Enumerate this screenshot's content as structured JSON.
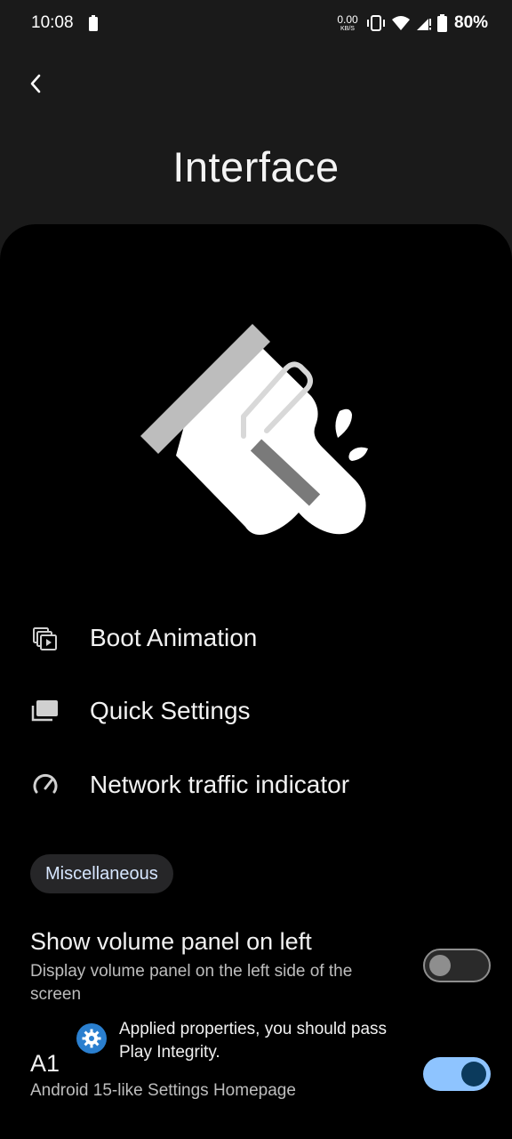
{
  "status_bar": {
    "time": "10:08",
    "net_speed_value": "0.00",
    "net_speed_unit": "KB/S",
    "battery_percent": "80%"
  },
  "header": {
    "back_icon": "chevron-left-icon",
    "title": "Interface"
  },
  "menu": {
    "items": [
      {
        "label": "Boot Animation",
        "icon": "slideshow-icon"
      },
      {
        "label": "Quick Settings",
        "icon": "tiles-icon"
      },
      {
        "label": "Network traffic indicator",
        "icon": "speedometer-icon"
      }
    ]
  },
  "misc": {
    "chip_label": "Miscellaneous",
    "settings": [
      {
        "title": "Show volume panel on left",
        "summary": "Display volume panel on the left side of the screen",
        "enabled": false
      },
      {
        "title": "A1",
        "summary": "Android 15-like Settings Homepage",
        "enabled": true
      }
    ]
  },
  "toast": {
    "icon": "settings-gear-icon",
    "message": "Applied properties, you should pass Play Integrity."
  },
  "colors": {
    "background": "#1a1a1a",
    "panel": "#000000",
    "accent": "#8ec4ff",
    "chip": "#262628"
  }
}
